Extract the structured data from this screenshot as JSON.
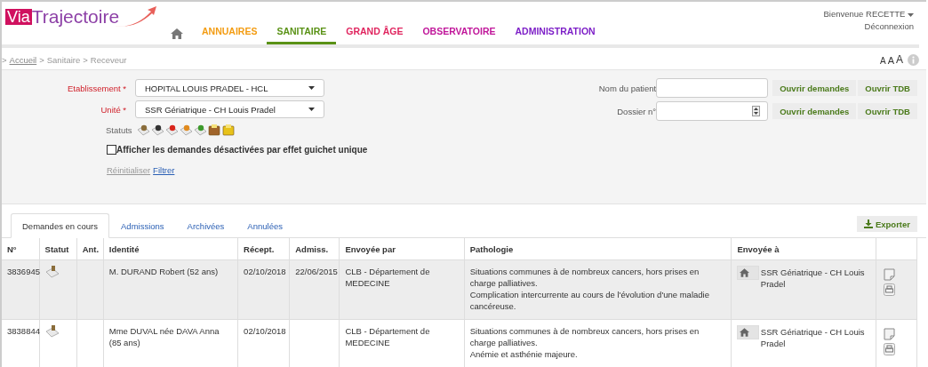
{
  "logo": {
    "prefix": "Via",
    "name": "Trajectoire"
  },
  "nav": [
    {
      "label": "ANNUAIRES",
      "color": "#f39c12",
      "selected": false
    },
    {
      "label": "SANITAIRE",
      "color": "#5a9216",
      "selected": true
    },
    {
      "label": "GRAND ÂGE",
      "color": "#e0245e",
      "selected": false
    },
    {
      "label": "OBSERVATOIRE",
      "color": "#c0169a",
      "selected": false
    },
    {
      "label": "ADMINISTRATION",
      "color": "#7d1fc7",
      "selected": false
    }
  ],
  "user": {
    "welcome": "Bienvenue RECETTE",
    "logout": "Déconnexion"
  },
  "breadcrumb": {
    "sep": ">",
    "home": "Accueil",
    "items": [
      "Sanitaire",
      "Receveur"
    ]
  },
  "font_sizes": [
    "A",
    "A",
    "A"
  ],
  "filters": {
    "etablissement": {
      "label": "Etablissement",
      "required": "*",
      "value": "HOPITAL LOUIS PRADEL - HCL"
    },
    "unite": {
      "label": "Unité",
      "required": "*",
      "value": "SSR Gériatrique - CH Louis Pradel"
    },
    "statuts_label": "Statuts",
    "statuts": [
      {
        "kind": "wait"
      },
      {
        "kind": "car"
      },
      {
        "kind": "refused"
      },
      {
        "kind": "question"
      },
      {
        "kind": "accepted"
      },
      {
        "kind": "transfer"
      },
      {
        "kind": "folder"
      }
    ],
    "checkbox": {
      "label": "Afficher les demandes désactivées par effet guichet unique",
      "checked": false
    },
    "reset": "Réinitialiser",
    "filter": "Filtrer",
    "search": [
      {
        "label": "Nom du patient",
        "kind": "text",
        "open": "Ouvrir demandes",
        "tdb": "Ouvrir TDB"
      },
      {
        "label": "Dossier n°",
        "kind": "number",
        "open": "Ouvrir demandes",
        "tdb": "Ouvrir TDB"
      }
    ]
  },
  "tabs": [
    {
      "label": "Demandes en cours",
      "selected": true
    },
    {
      "label": "Admissions",
      "selected": false
    },
    {
      "label": "Archivées",
      "selected": false
    },
    {
      "label": "Annulées",
      "selected": false
    }
  ],
  "export": "Exporter",
  "table": {
    "columns": [
      "N°",
      "Statut",
      "Ant.",
      "Identité",
      "Récept.",
      "Admiss.",
      "Envoyée par",
      "Pathologie",
      "Envoyée à"
    ],
    "rows": [
      {
        "selected": true,
        "num": "3836945",
        "identity": "M. DURAND Robert (52 ans)",
        "recept": "02/10/2018",
        "admiss": "22/06/2015",
        "sender": "CLB - Département de MEDECINE",
        "pathology": [
          "Situations communes à de nombreux cancers, hors prises en charge palliatives.",
          "Complication intercurrente au cours de l'évolution d'une maladie cancéreuse."
        ],
        "dest": "SSR Gériatrique - CH Louis Pradel"
      },
      {
        "selected": false,
        "num": "3838844",
        "identity": "Mme DUVAL née DAVA Anna (85 ans)",
        "recept": "02/10/2018",
        "sender": "CLB - Département de MEDECINE",
        "pathology": [
          "Situations communes à de nombreux cancers, hors prises en charge palliatives.",
          "Anémie et asthénie majeure."
        ],
        "dest": "SSR Gériatrique - CH Louis Pradel"
      }
    ]
  }
}
